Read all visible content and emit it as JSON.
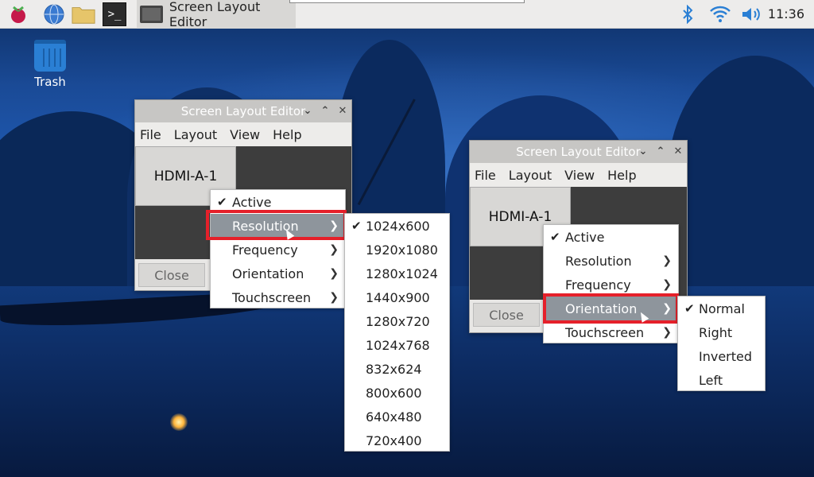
{
  "taskbar": {
    "icons": [
      "raspberry-icon",
      "globe-icon",
      "folder-icon",
      "terminal-icon"
    ],
    "task_title": "Screen Layout Editor",
    "tray_icons": [
      "bluetooth-icon",
      "wifi-icon",
      "volume-icon"
    ],
    "clock": "11:36"
  },
  "desktop": {
    "trash_label": "Trash"
  },
  "window1": {
    "title": "Screen Layout Editor",
    "menus": [
      "File",
      "Layout",
      "View",
      "Help"
    ],
    "monitor_label": "HDMI-A-1",
    "close_label": "Close",
    "context_menu": [
      {
        "label": "Active",
        "checked": true,
        "submenu": false
      },
      {
        "label": "Resolution",
        "checked": false,
        "submenu": true,
        "selected": true
      },
      {
        "label": "Frequency",
        "checked": false,
        "submenu": true
      },
      {
        "label": "Orientation",
        "checked": false,
        "submenu": true
      },
      {
        "label": "Touchscreen",
        "checked": false,
        "submenu": true
      }
    ],
    "resolution_submenu": [
      {
        "label": "1024x600",
        "checked": true
      },
      {
        "label": "1920x1080"
      },
      {
        "label": "1280x1024"
      },
      {
        "label": "1440x900"
      },
      {
        "label": "1280x720"
      },
      {
        "label": "1024x768"
      },
      {
        "label": "832x624"
      },
      {
        "label": "800x600"
      },
      {
        "label": "640x480"
      },
      {
        "label": "720x400"
      }
    ]
  },
  "window2": {
    "title": "Screen Layout Editor",
    "menus": [
      "File",
      "Layout",
      "View",
      "Help"
    ],
    "monitor_label": "HDMI-A-1",
    "close_label": "Close",
    "context_menu": [
      {
        "label": "Active",
        "checked": true,
        "submenu": false
      },
      {
        "label": "Resolution",
        "checked": false,
        "submenu": true
      },
      {
        "label": "Frequency",
        "checked": false,
        "submenu": true
      },
      {
        "label": "Orientation",
        "checked": false,
        "submenu": true,
        "selected": true
      },
      {
        "label": "Touchscreen",
        "checked": false,
        "submenu": true
      }
    ],
    "orientation_submenu": [
      {
        "label": "Normal",
        "checked": true
      },
      {
        "label": "Right"
      },
      {
        "label": "Inverted"
      },
      {
        "label": "Left"
      }
    ]
  },
  "colors": {
    "highlight_box": "#e5202a",
    "menu_selected": "#8e959c",
    "accent": "#2a7fd4"
  }
}
